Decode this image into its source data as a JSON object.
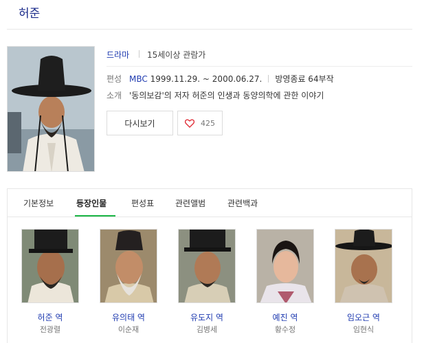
{
  "page": {
    "title": "허준"
  },
  "info": {
    "genre": "드라마",
    "rating": "15세이상 관람가",
    "schedule_label": "편성",
    "broadcaster": "MBC",
    "period": "1999.11.29. ~ 2000.06.27.",
    "status": "방영종료 64부작",
    "summary_label": "소개",
    "summary": "'동의보감'의 저자 허준의 인생과 동양의학에 관한 이야기"
  },
  "actions": {
    "watch_label": "다시보기",
    "like_count": "425"
  },
  "tabs": [
    {
      "label": "기본정보"
    },
    {
      "label": "등장인물"
    },
    {
      "label": "편성표"
    },
    {
      "label": "관련앨범"
    },
    {
      "label": "관련백과"
    }
  ],
  "active_tab": "등장인물",
  "cast": [
    {
      "role": "허준 역",
      "actor": "전광렬"
    },
    {
      "role": "유의태 역",
      "actor": "이순재"
    },
    {
      "role": "유도지 역",
      "actor": "김병세"
    },
    {
      "role": "예진 역",
      "actor": "황수정"
    },
    {
      "role": "임오근 역",
      "actor": "임현식"
    }
  ],
  "colors": {
    "accent_green": "#19b443",
    "link_blue": "#1f3bb0",
    "title_navy": "#1a2a8a"
  },
  "icons": {
    "like": "heart-icon"
  }
}
